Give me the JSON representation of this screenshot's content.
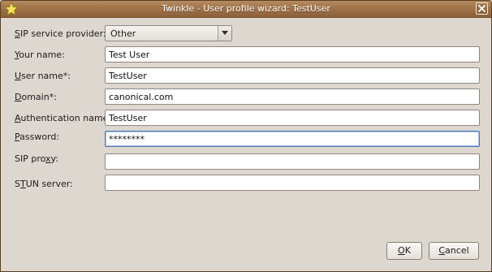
{
  "window": {
    "title": "Twinkle - User profile wizard: TestUser"
  },
  "form": {
    "sip_provider": {
      "label": "SIP service provider:",
      "accesskey": "S",
      "rest": "IP service provider:",
      "value": "Other"
    },
    "your_name": {
      "label": "Your name:",
      "accesskey": "Y",
      "rest": "our name:",
      "value": "Test User"
    },
    "user_name": {
      "label": "User name*:",
      "accesskey": "U",
      "rest": "ser name*:",
      "value": "TestUser"
    },
    "domain": {
      "label": "Domain*:",
      "accesskey": "D",
      "rest": "omain*:",
      "value": "canonical.com"
    },
    "auth_name": {
      "label": "Authentication name:",
      "accesskey": "A",
      "rest": "uthentication name:",
      "value": "TestUser"
    },
    "password": {
      "label": "Password:",
      "accesskey": "P",
      "rest": "assword:",
      "value": "********"
    },
    "sip_proxy": {
      "label": "SIP proxy:",
      "pre": "SIP pro",
      "accesskey": "x",
      "post": "y:",
      "value": ""
    },
    "stun_server": {
      "label": "STUN server:",
      "pre": "S",
      "accesskey": "T",
      "post": "UN server:",
      "value": ""
    }
  },
  "buttons": {
    "ok": {
      "label": "OK",
      "accesskey": "O",
      "rest": "K"
    },
    "cancel": {
      "label": "Cancel",
      "accesskey": "C",
      "rest": "ancel"
    }
  },
  "colors": {
    "titlebar": "#9d7047",
    "window_bg": "#ddd7cf",
    "focus_border": "#4d79b4"
  },
  "icons": {
    "app": "star-icon",
    "close": "close-icon",
    "combo_arrow": "chevron-down-icon"
  }
}
